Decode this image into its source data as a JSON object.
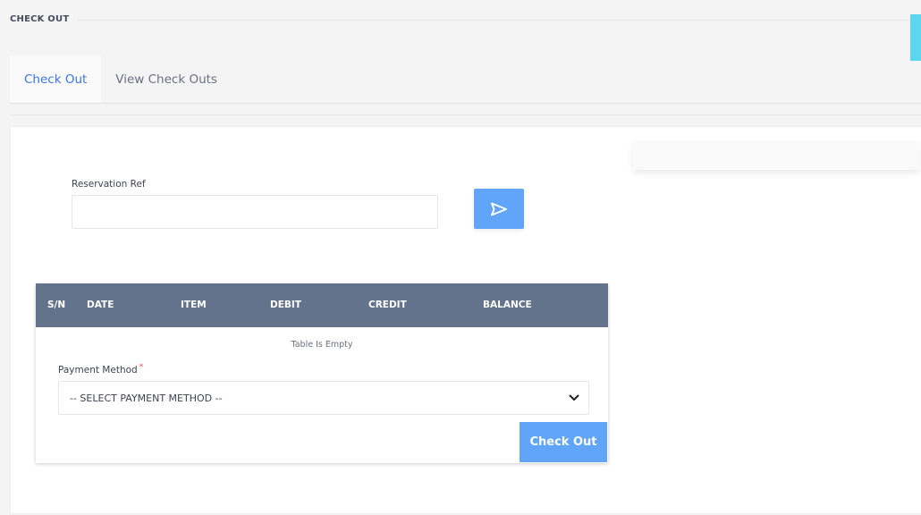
{
  "page": {
    "title": "CHECK OUT"
  },
  "tabs": [
    {
      "label": "Check Out",
      "active": true
    },
    {
      "label": "View Check Outs",
      "active": false
    }
  ],
  "reservation": {
    "label": "Reservation Ref",
    "value": "",
    "placeholder": ""
  },
  "table": {
    "columns": [
      "S/N",
      "DATE",
      "ITEM",
      "DEBIT",
      "CREDIT",
      "BALANCE"
    ],
    "rows": [],
    "empty_message": "Table Is Empty"
  },
  "payment": {
    "label": "Payment Method",
    "required_marker": "*",
    "selected": "-- SELECT PAYMENT METHOD --"
  },
  "actions": {
    "checkout_label": "Check Out"
  },
  "colors": {
    "accent": "#60a5f8",
    "table_header": "#63738b",
    "active_tab": "#3b75e0",
    "corner_accent": "#5ad6ef"
  },
  "icons": {
    "send": "send-icon",
    "select": "chevron-down-icon"
  }
}
